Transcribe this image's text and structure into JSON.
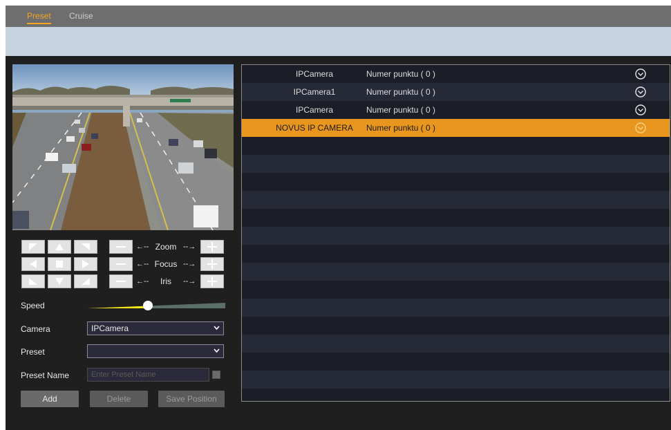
{
  "tabs": [
    {
      "label": "Preset",
      "active": true
    },
    {
      "label": "Cruise",
      "active": false
    }
  ],
  "ptz": {
    "lens": [
      {
        "label": "Zoom"
      },
      {
        "label": "Focus"
      },
      {
        "label": "Iris"
      }
    ],
    "arrow_left": "←--",
    "arrow_right": "--→"
  },
  "form": {
    "speed_label": "Speed",
    "speed_value_fraction": 0.44,
    "camera_label": "Camera",
    "camera_value": "IPCamera",
    "preset_label": "Preset",
    "preset_value": "",
    "preset_name_label": "Preset Name",
    "preset_name_placeholder": "Enter Preset Name"
  },
  "buttons": {
    "add": "Add",
    "delete": "Delete",
    "save_position": "Save Position"
  },
  "table": {
    "rows": [
      {
        "camera": "IPCamera",
        "preset": "Numer punktu ( 0 )",
        "selected": false
      },
      {
        "camera": "IPCamera1",
        "preset": "Numer punktu ( 0 )",
        "selected": false
      },
      {
        "camera": "IPCamera",
        "preset": "Numer punktu ( 0 )",
        "selected": false
      },
      {
        "camera": "NOVUS IP CAMERA",
        "preset": "Numer punktu ( 0 )",
        "selected": true
      }
    ]
  },
  "colors": {
    "accent": "#f5a623",
    "selected_row": "#e8961d",
    "slider_active": "#f5e61a",
    "slider_inactive": "#5c6e6a"
  }
}
